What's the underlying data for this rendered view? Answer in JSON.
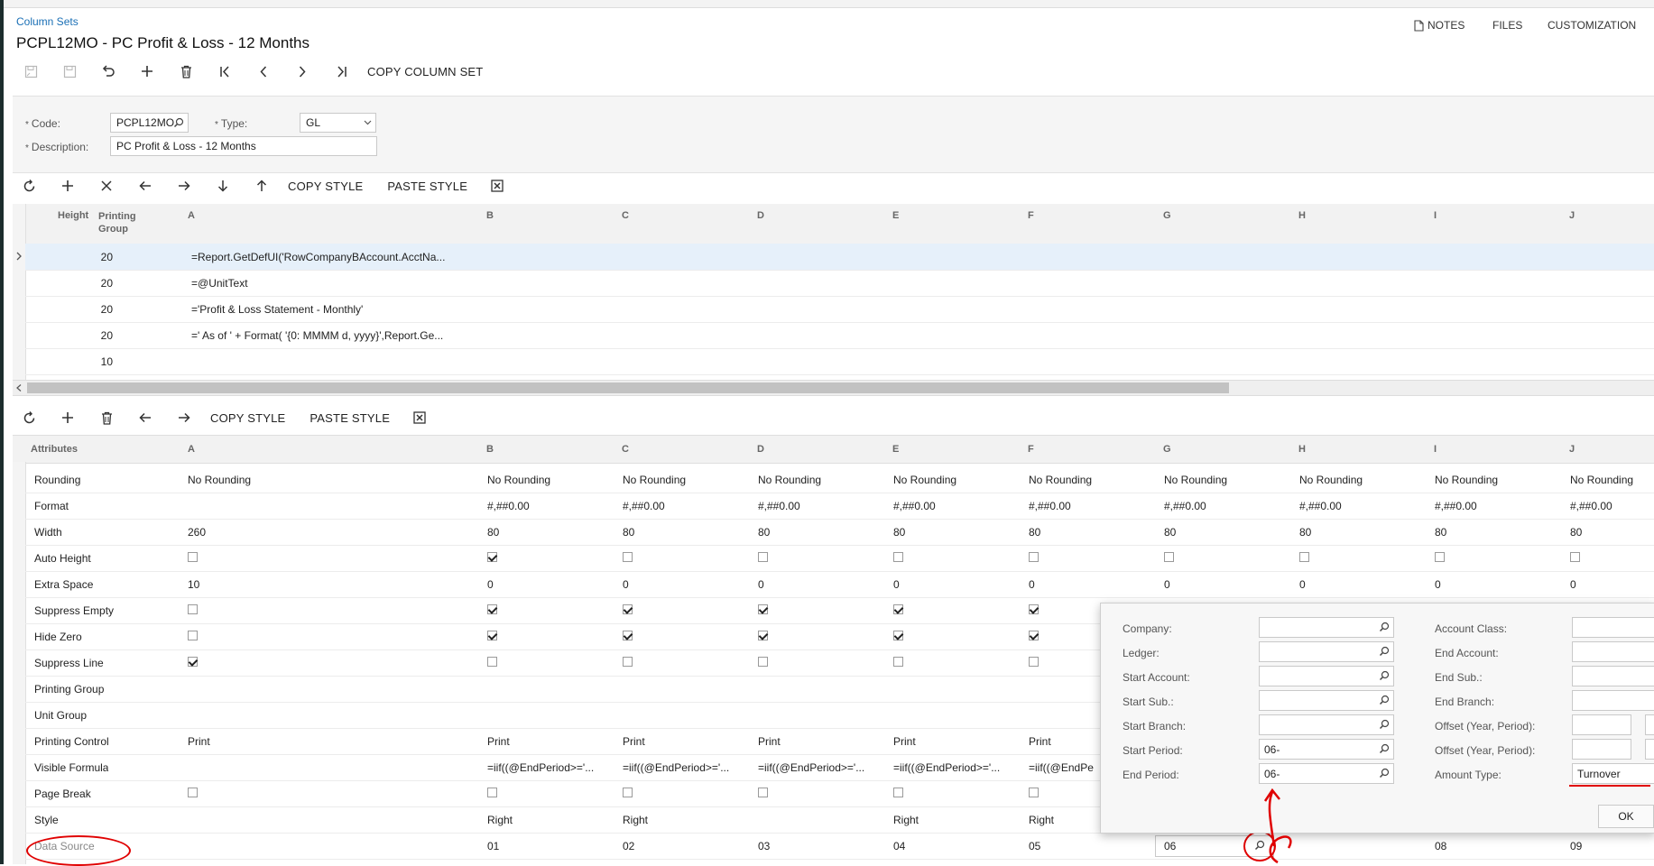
{
  "breadcrumb": "Column Sets",
  "page_title": "PCPL12MO - PC Profit & Loss - 12 Months",
  "top_actions": {
    "notes": "NOTES",
    "files": "FILES",
    "customization": "CUSTOMIZATION"
  },
  "main_toolbar": {
    "copy_column_set": "COPY COLUMN SET"
  },
  "form": {
    "code_label": "Code:",
    "code_value": "PCPL12MO",
    "type_label": "Type:",
    "type_value": "GL",
    "description_label": "Description:",
    "description_value": "PC Profit & Loss - 12 Months",
    "required_mark": "*"
  },
  "grid_toolbar": {
    "copy_style": "COPY STYLE",
    "paste_style": "PASTE STYLE"
  },
  "header_grid": {
    "columns": [
      "Height",
      "Printing Group",
      "A",
      "B",
      "C",
      "D",
      "E",
      "F",
      "G",
      "H",
      "I",
      "J"
    ],
    "printing_group_line1": "Printing",
    "printing_group_line2": "Group",
    "rows": [
      {
        "height": "20",
        "a": "=Report.GetDefUI('RowCompanyBAccount.AcctNa..."
      },
      {
        "height": "20",
        "a": "=@UnitText"
      },
      {
        "height": "20",
        "a": "='Profit & Loss Statement - Monthly'"
      },
      {
        "height": "20",
        "a": "=' As of ' + Format( '{0: MMMM d, yyyy}',Report.Ge..."
      },
      {
        "height": "10",
        "a": ""
      }
    ]
  },
  "attr_grid": {
    "col_attributes": "Attributes",
    "columns": [
      "A",
      "B",
      "C",
      "D",
      "E",
      "F",
      "G",
      "H",
      "I",
      "J"
    ],
    "rows": [
      {
        "name": "Rounding",
        "A": "No Rounding",
        "B": "No Rounding",
        "C": "No Rounding",
        "D": "No Rounding",
        "E": "No Rounding",
        "F": "No Rounding",
        "G": "No Rounding",
        "H": "No Rounding",
        "I": "No Rounding",
        "J": "No Rounding"
      },
      {
        "name": "Format",
        "A": "",
        "B": "#,##0.00",
        "C": "#,##0.00",
        "D": "#,##0.00",
        "E": "#,##0.00",
        "F": "#,##0.00",
        "G": "#,##0.00",
        "H": "#,##0.00",
        "I": "#,##0.00",
        "J": "#,##0.00"
      },
      {
        "name": "Width",
        "A": "260",
        "B": "80",
        "C": "80",
        "D": "80",
        "E": "80",
        "F": "80",
        "G": "80",
        "H": "80",
        "I": "80",
        "J": "80"
      },
      {
        "name": "Auto Height",
        "checks": [
          false,
          true,
          false,
          false,
          false,
          false,
          false,
          false,
          false,
          false
        ]
      },
      {
        "name": "Extra Space",
        "A": "10",
        "B": "0",
        "C": "0",
        "D": "0",
        "E": "0",
        "F": "0",
        "G": "0",
        "H": "0",
        "I": "0",
        "J": "0"
      },
      {
        "name": "Suppress Empty",
        "checks": [
          false,
          true,
          true,
          true,
          true,
          true,
          null,
          null,
          null,
          null
        ]
      },
      {
        "name": "Hide Zero",
        "checks": [
          false,
          true,
          true,
          true,
          true,
          true,
          null,
          null,
          null,
          null
        ]
      },
      {
        "name": "Suppress Line",
        "checks": [
          true,
          false,
          false,
          false,
          false,
          false,
          null,
          null,
          null,
          null
        ]
      },
      {
        "name": "Printing Group"
      },
      {
        "name": "Unit Group"
      },
      {
        "name": "Printing Control",
        "A": "Print",
        "B": "Print",
        "C": "Print",
        "D": "Print",
        "E": "Print",
        "F": "Print"
      },
      {
        "name": "Visible Formula",
        "A": "",
        "B": "=iif((@EndPeriod>='...",
        "C": "=iif((@EndPeriod>='...",
        "D": "=iif((@EndPeriod>='...",
        "E": "=iif((@EndPeriod>='...",
        "F": "=iif((@EndPe"
      },
      {
        "name": "Page Break",
        "checks": [
          false,
          false,
          false,
          false,
          false,
          false,
          null,
          null,
          null,
          null
        ]
      },
      {
        "name": "Style",
        "A": "",
        "B": "Right",
        "C": "Right",
        "D": "",
        "E": "Right",
        "F": "Right"
      },
      {
        "name": "Data Source",
        "A": "",
        "B": "01",
        "C": "02",
        "D": "03",
        "E": "04",
        "F": "05",
        "G": "06",
        "H": "",
        "I": "08",
        "J": "09"
      }
    ]
  },
  "popup": {
    "left_labels": [
      "Company:",
      "Ledger:",
      "Start Account:",
      "Start Sub.:",
      "Start Branch:",
      "Start Period:",
      "End Period:"
    ],
    "left_values": [
      "",
      "",
      "",
      "",
      "",
      "06-",
      "06-"
    ],
    "right_labels": [
      "Account Class:",
      "End Account:",
      "End Sub.:",
      "End Branch:",
      "Offset (Year, Period):",
      "Offset (Year, Period):",
      "Amount Type:"
    ],
    "amount_type": "Turnover",
    "ok_label": "OK"
  },
  "colors": {
    "link": "#1a6fb5",
    "annotation_red": "#e00000",
    "selected_row": "#e6f0fa"
  }
}
